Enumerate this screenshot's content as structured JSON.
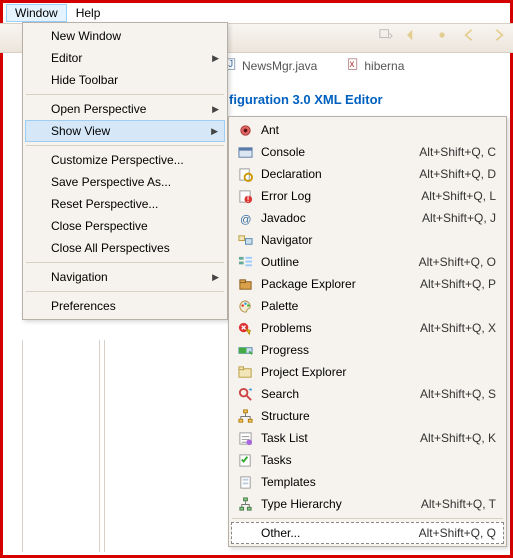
{
  "menubar": {
    "window": "Window",
    "help": "Help"
  },
  "tabs": {
    "news": "NewsMgr.java",
    "hibern": "hiberna"
  },
  "editor": {
    "title": "figuration 3.0 XML Editor"
  },
  "menu": {
    "new_window": "New Window",
    "editor": "Editor",
    "hide_toolbar": "Hide Toolbar",
    "open_perspective": "Open Perspective",
    "show_view": "Show View",
    "customize": "Customize Perspective...",
    "save_as": "Save Perspective As...",
    "reset": "Reset Perspective...",
    "close_perspective": "Close Perspective",
    "close_all": "Close All Perspectives",
    "navigation": "Navigation",
    "preferences": "Preferences"
  },
  "submenu": [
    {
      "icon": "ant-icon",
      "label": "Ant",
      "shortcut": ""
    },
    {
      "icon": "console-icon",
      "label": "Console",
      "shortcut": "Alt+Shift+Q, C"
    },
    {
      "icon": "declaration-icon",
      "label": "Declaration",
      "shortcut": "Alt+Shift+Q, D"
    },
    {
      "icon": "error-log-icon",
      "label": "Error Log",
      "shortcut": "Alt+Shift+Q, L"
    },
    {
      "icon": "javadoc-icon",
      "label": "Javadoc",
      "shortcut": "Alt+Shift+Q, J"
    },
    {
      "icon": "navigator-icon",
      "label": "Navigator",
      "shortcut": ""
    },
    {
      "icon": "outline-icon",
      "label": "Outline",
      "shortcut": "Alt+Shift+Q, O"
    },
    {
      "icon": "package-explorer-icon",
      "label": "Package Explorer",
      "shortcut": "Alt+Shift+Q, P"
    },
    {
      "icon": "palette-icon",
      "label": "Palette",
      "shortcut": ""
    },
    {
      "icon": "problems-icon",
      "label": "Problems",
      "shortcut": "Alt+Shift+Q, X"
    },
    {
      "icon": "progress-icon",
      "label": "Progress",
      "shortcut": ""
    },
    {
      "icon": "project-explorer-icon",
      "label": "Project Explorer",
      "shortcut": ""
    },
    {
      "icon": "search-icon",
      "label": "Search",
      "shortcut": "Alt+Shift+Q, S"
    },
    {
      "icon": "structure-icon",
      "label": "Structure",
      "shortcut": ""
    },
    {
      "icon": "task-list-icon",
      "label": "Task List",
      "shortcut": "Alt+Shift+Q, K"
    },
    {
      "icon": "tasks-icon",
      "label": "Tasks",
      "shortcut": ""
    },
    {
      "icon": "templates-icon",
      "label": "Templates",
      "shortcut": ""
    },
    {
      "icon": "type-hierarchy-icon",
      "label": "Type Hierarchy",
      "shortcut": "Alt+Shift+Q, T"
    }
  ],
  "other": {
    "label": "Other...",
    "shortcut": "Alt+Shift+Q, Q"
  }
}
